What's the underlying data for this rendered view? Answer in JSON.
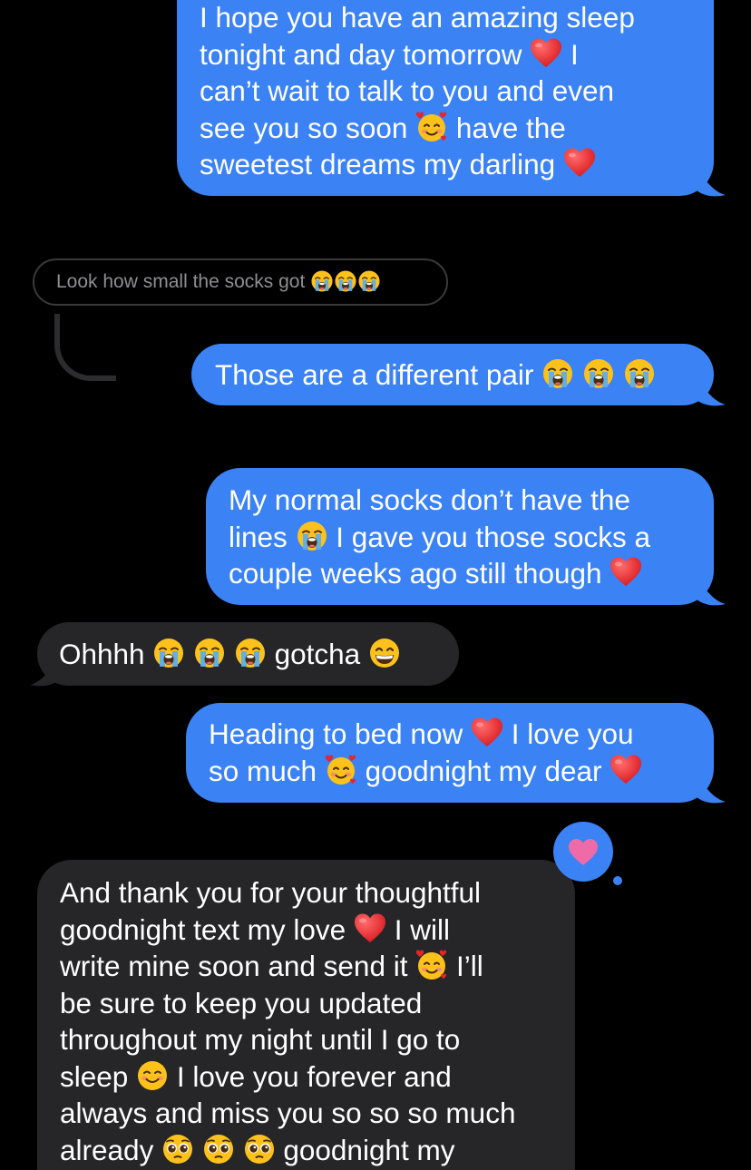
{
  "colors": {
    "sent_bubble": "#3b82f5",
    "received_bubble": "#262628",
    "background": "#000000",
    "quoted_text": "#8e8e93",
    "tapback_heart": "#ef6ba8"
  },
  "messages": [
    {
      "direction": "sent",
      "lines": [
        [
          "I hope you have an amazing sleep"
        ],
        [
          "tonight and day tomorrow ",
          {
            "emoji": "red-heart"
          },
          " I"
        ],
        [
          "can’t wait to talk to you and even"
        ],
        [
          "see you so soon ",
          {
            "emoji": "smiling-face-with-hearts"
          },
          " have the"
        ],
        [
          "sweetest dreams my darling ",
          {
            "emoji": "red-heart"
          }
        ]
      ]
    },
    {
      "direction": "quoted-reply",
      "lines": [
        [
          "Look how small the socks got ",
          {
            "emoji": "loudly-crying-face"
          },
          {
            "emoji": "loudly-crying-face"
          },
          {
            "emoji": "loudly-crying-face"
          }
        ]
      ]
    },
    {
      "direction": "sent",
      "lines": [
        [
          "Those are a different pair ",
          {
            "emoji": "loudly-crying-face"
          },
          " ",
          {
            "emoji": "loudly-crying-face"
          },
          " ",
          {
            "emoji": "loudly-crying-face"
          }
        ]
      ]
    },
    {
      "direction": "sent",
      "lines": [
        [
          "My normal socks don’t have the"
        ],
        [
          "lines ",
          {
            "emoji": "loudly-crying-face"
          },
          " I gave you those socks a"
        ],
        [
          "couple weeks ago still though ",
          {
            "emoji": "red-heart"
          }
        ]
      ]
    },
    {
      "direction": "received",
      "lines": [
        [
          "Ohhhh ",
          {
            "emoji": "loudly-crying-face"
          },
          " ",
          {
            "emoji": "loudly-crying-face"
          },
          " ",
          {
            "emoji": "loudly-crying-face"
          },
          " gotcha ",
          {
            "emoji": "grinning-face"
          }
        ]
      ]
    },
    {
      "direction": "sent",
      "lines": [
        [
          "Heading to bed now ",
          {
            "emoji": "red-heart"
          },
          " I love you"
        ],
        [
          "so much ",
          {
            "emoji": "smiling-face-with-hearts"
          },
          " goodnight my dear ",
          {
            "emoji": "red-heart"
          }
        ]
      ]
    },
    {
      "direction": "received",
      "tapback": "heart",
      "lines": [
        [
          "And thank you for your thoughtful"
        ],
        [
          "goodnight text my love ",
          {
            "emoji": "red-heart"
          },
          " I will"
        ],
        [
          "write mine soon and send it ",
          {
            "emoji": "smiling-face-with-hearts"
          },
          " I’ll"
        ],
        [
          "be sure to keep you updated"
        ],
        [
          "throughout my night until I go to"
        ],
        [
          "sleep ",
          {
            "emoji": "smiling-face"
          },
          " I love you forever and"
        ],
        [
          "always and miss you so so so much"
        ],
        [
          "already ",
          {
            "emoji": "pleading-face"
          },
          " ",
          {
            "emoji": "pleading-face"
          },
          " ",
          {
            "emoji": "pleading-face"
          },
          " goodnight my"
        ]
      ]
    }
  ]
}
